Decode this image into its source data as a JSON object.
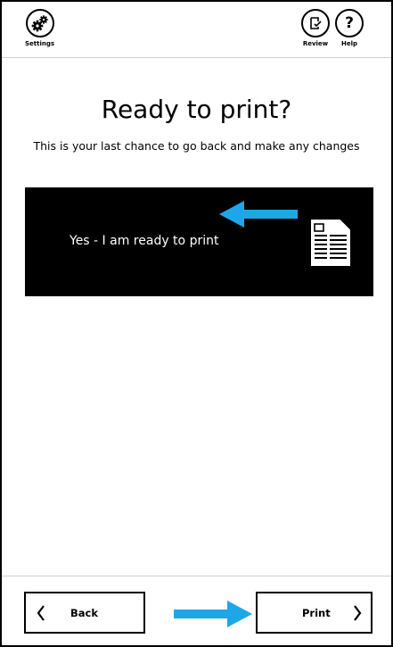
{
  "header": {
    "settings_label": "Settings",
    "review_label": "Review",
    "help_label": "Help",
    "help_glyph": "?"
  },
  "main": {
    "title": "Ready to print?",
    "subtitle": "This is your last chance to go back and make any changes",
    "ready_option": {
      "label": "Yes - I am ready to print",
      "icon": "document-icon",
      "hint_arrow": "arrow-left-icon"
    }
  },
  "footer": {
    "back_label": "Back",
    "print_label": "Print",
    "hint_arrow": "arrow-right-icon"
  },
  "colors": {
    "accent": "#1ea7e8",
    "card_bg": "#000000",
    "text": "#000000"
  }
}
